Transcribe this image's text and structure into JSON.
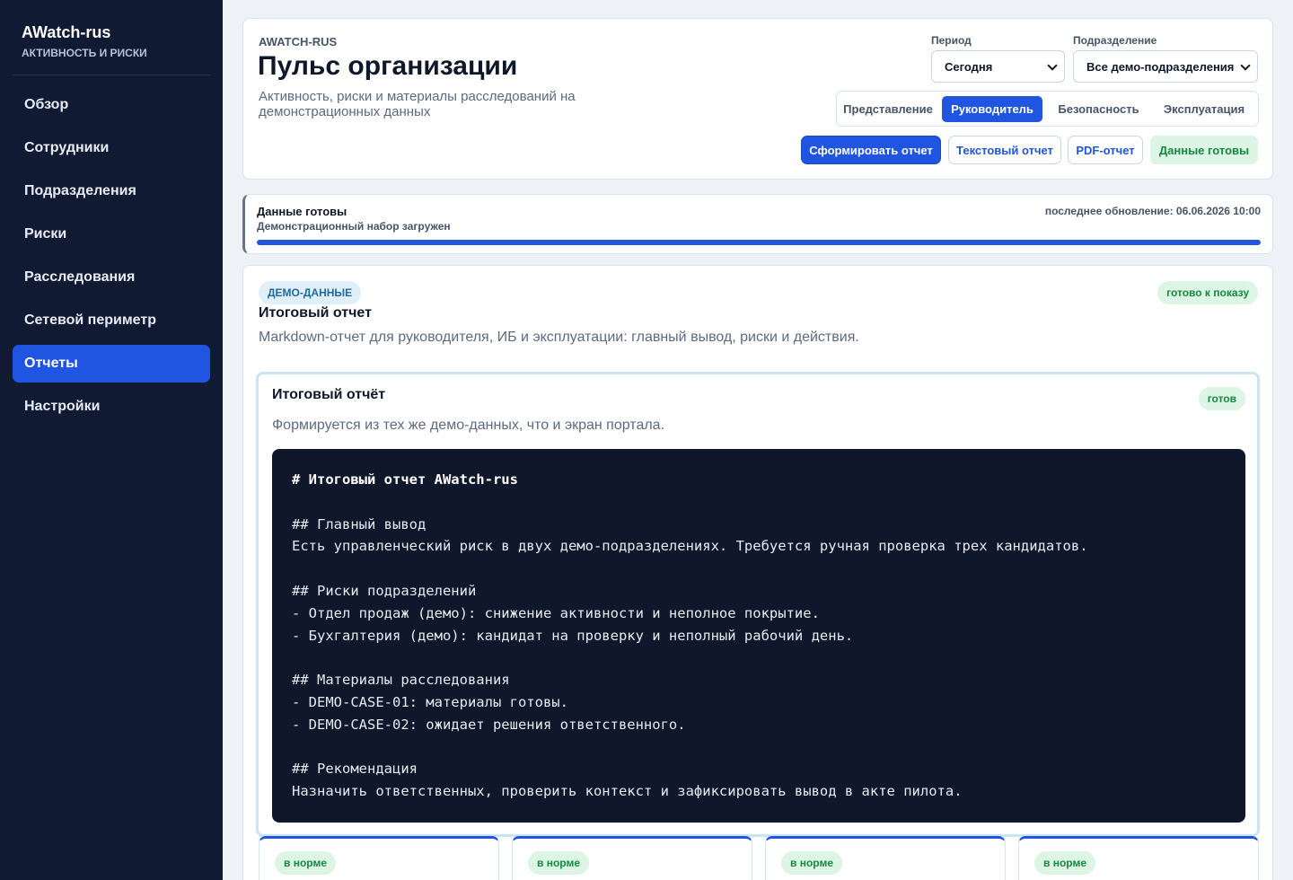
{
  "sidebar": {
    "brand_title": "AWatch-rus",
    "brand_subtitle": "АКТИВНОСТЬ И РИСКИ",
    "items": [
      {
        "label": "Обзор",
        "active": false
      },
      {
        "label": "Сотрудники",
        "active": false
      },
      {
        "label": "Подразделения",
        "active": false
      },
      {
        "label": "Риски",
        "active": false
      },
      {
        "label": "Расследования",
        "active": false
      },
      {
        "label": "Сетевой периметр",
        "active": false
      },
      {
        "label": "Отчеты",
        "active": true
      },
      {
        "label": "Настройки",
        "active": false
      }
    ]
  },
  "header": {
    "eyebrow": "AWATCH-RUS",
    "title": "Пульс организации",
    "subtitle": "Активность, риски и материалы расследований на демонстрационных данных",
    "period_label": "Период",
    "period_value": "Сегодня",
    "department_label": "Подразделение",
    "department_value": "Все демо-подразделения",
    "views": [
      {
        "label": "Представление",
        "active": false
      },
      {
        "label": "Руководитель",
        "active": true
      },
      {
        "label": "Безопасность",
        "active": false
      },
      {
        "label": "Эксплуатация",
        "active": false
      }
    ],
    "actions": {
      "generate": "Сформировать отчет",
      "text_report": "Текстовый отчет",
      "pdf_report": "PDF-отчет",
      "data_ready": "Данные готовы"
    }
  },
  "status": {
    "title": "Данные готовы",
    "subtitle": "Демонстрационный набор загружен",
    "updated": "последнее обновление: 06.06.2026 10:00",
    "progress": 1.0
  },
  "main": {
    "badge": "ДЕМО-ДАННЫЕ",
    "ready_badge": "готово к показу",
    "title": "Итоговый отчет",
    "description": "Markdown-отчет для руководителя, ИБ и эксплуатации: главный вывод, риски и действия.",
    "report": {
      "title": "Итоговый отчёт",
      "status": "готов",
      "description": "Формируется из тех же демо-данных, что и экран портала.",
      "lines": [
        "# Итоговый отчет AWatch-rus",
        "",
        "## Главный вывод",
        "Есть управленческий риск в двух демо-подразделениях. Требуется ручная проверка трех кандидатов.",
        "",
        "## Риски подразделений",
        "- Отдел продаж (демо): снижение активности и неполное покрытие.",
        "- Бухгалтерия (демо): кандидат на проверку и неполный рабочий день.",
        "",
        "## Материалы расследования",
        "- DEMO-CASE-01: материалы готовы.",
        "- DEMO-CASE-02: ожидает решения ответственного.",
        "",
        "## Рекомендация",
        "Назначить ответственных, проверить контекст и зафиксировать вывод в акте пилота."
      ]
    },
    "mini_cards": [
      {
        "status": "в норме"
      },
      {
        "status": "в норме"
      },
      {
        "status": "в норме"
      },
      {
        "status": "в норме"
      }
    ]
  },
  "colors": {
    "sidebar_bg": "#101a33",
    "accent": "#1f55e0",
    "success_bg": "#dcf5e4",
    "success_text": "#16873f",
    "code_bg": "#0f172a"
  }
}
